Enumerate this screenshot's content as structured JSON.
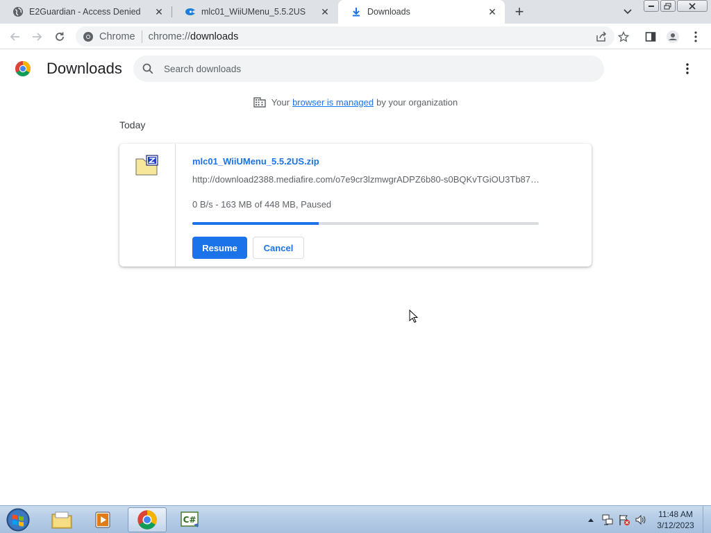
{
  "tabs": [
    {
      "title": "E2Guardian - Access Denied",
      "icon": "globe-icon"
    },
    {
      "title": "mlc01_WiiUMenu_5.5.2US",
      "icon": "mediafire-icon"
    },
    {
      "title": "Downloads",
      "icon": "download-icon"
    }
  ],
  "toolbar": {
    "chip": "Chrome",
    "url_scheme": "chrome://",
    "url_path": "downloads"
  },
  "downloads": {
    "title": "Downloads",
    "search_placeholder": "Search downloads",
    "managed_prefix": "Your",
    "managed_link": "browser is managed",
    "managed_suffix": "by your organization",
    "section": "Today",
    "item": {
      "file_name": "mlc01_WiiUMenu_5.5.2US.zip",
      "url": "http://download2388.mediafire.com/o7e9cr3lzmwgrADPZ6b80-s0BQKvTGiOU3Tb87…",
      "status": "0 B/s - 163 MB of 448 MB, Paused",
      "progress_fraction": 0.364,
      "resume_label": "Resume",
      "cancel_label": "Cancel"
    }
  },
  "taskbar": {
    "time": "11:48 AM",
    "date": "3/12/2023",
    "apps": [
      "file-explorer-icon",
      "media-player-icon",
      "chrome-icon",
      "csharp-icon"
    ]
  },
  "colors": {
    "accent": "#1a73e8",
    "tabstrip": "#dee1e6",
    "omnibox": "#f1f3f4"
  }
}
